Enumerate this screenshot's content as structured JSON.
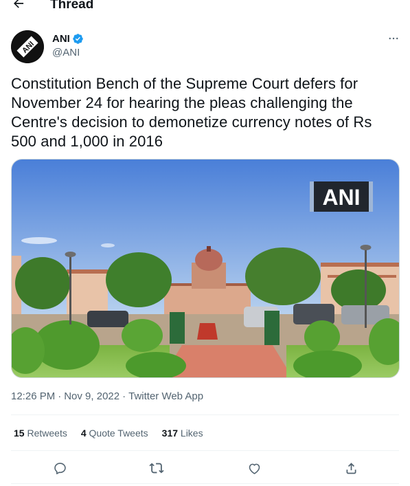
{
  "header": {
    "title": "Thread",
    "back_icon": "arrow-left-icon"
  },
  "author": {
    "name": "ANI",
    "handle": "@ANI",
    "verified_icon": "verified-badge-icon",
    "avatar_text": "ANI",
    "verified_color": "#1d9bf0"
  },
  "tweet": {
    "text": "Constitution Bench of the Supreme Court defers for November 24 for hearing the pleas challenging the Centre's decision to demonetize currency notes of Rs 500 and 1,000 in 2016",
    "media_watermark": "ANI",
    "time": "12:26 PM",
    "date": "Nov 9, 2022",
    "source": "Twitter Web App",
    "separator": "·"
  },
  "stats": {
    "retweets_count": "15",
    "retweets_label": "Retweets",
    "quotes_count": "4",
    "quotes_label": "Quote Tweets",
    "likes_count": "317",
    "likes_label": "Likes"
  },
  "actions": [
    {
      "name": "reply",
      "icon": "reply-icon"
    },
    {
      "name": "retweet",
      "icon": "retweet-icon"
    },
    {
      "name": "like",
      "icon": "heart-icon"
    },
    {
      "name": "share",
      "icon": "share-icon"
    }
  ],
  "colors": {
    "text_primary": "#0f1419",
    "text_secondary": "#536471",
    "divider": "#eff3f4",
    "icon": "#536471"
  }
}
